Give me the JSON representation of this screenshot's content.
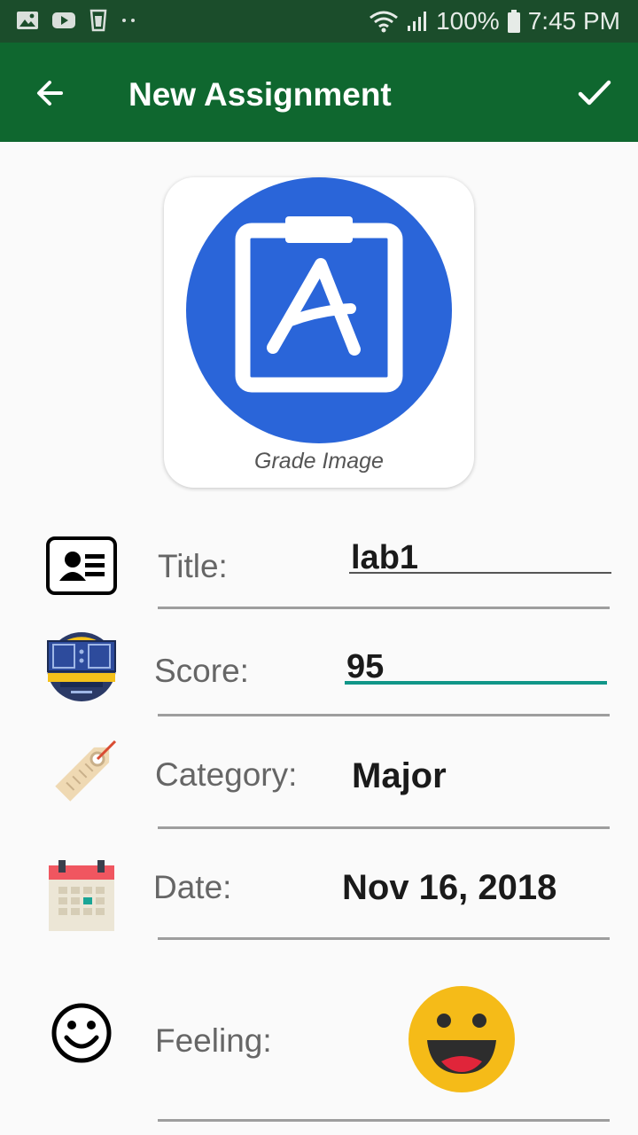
{
  "status_bar": {
    "battery": "100%",
    "time": "7:45 PM",
    "left_icons": [
      "image-icon",
      "youtube-icon",
      "cup-icon",
      "dots-icon"
    ],
    "right_icons": [
      "wifi-icon",
      "signal-icon",
      "battery-icon"
    ]
  },
  "app_bar": {
    "title": "New Assignment",
    "back_icon": "arrow-back-icon",
    "confirm_icon": "check-icon",
    "background": "#0f672f"
  },
  "grade_image": {
    "caption": "Grade Image",
    "logo_letter": "A",
    "logo_color": "#2a65d9"
  },
  "form": {
    "title_label": "Title:",
    "title_value": "lab1",
    "score_label": "Score:",
    "score_value": "95",
    "category_label": "Category:",
    "category_value": "Major",
    "date_label": "Date:",
    "date_value": "Nov 16, 2018",
    "feeling_label": "Feeling:",
    "feeling_value": "happy-emoji"
  },
  "colors": {
    "accent": "#109688",
    "status_bar": "#1b4d2b",
    "emoji": "#f5bb18"
  }
}
